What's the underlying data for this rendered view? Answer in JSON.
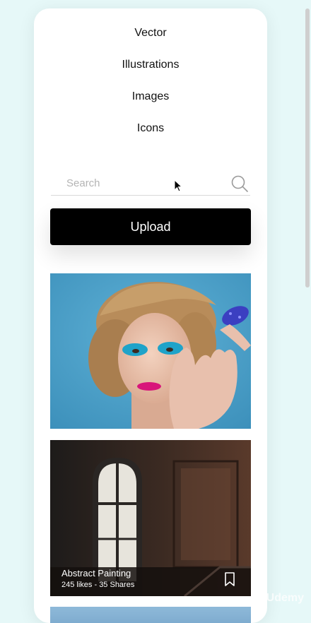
{
  "menu": {
    "items": [
      "Vector",
      "Illustrations",
      "Images",
      "Icons"
    ]
  },
  "search": {
    "placeholder": "Search",
    "value": "",
    "icon": "search-icon"
  },
  "upload": {
    "label": "Upload"
  },
  "cards": [
    {
      "image": "portrait-blue-eyeshadow",
      "title": "",
      "stats": ""
    },
    {
      "image": "abandoned-room-window",
      "title": "Abstract Painting",
      "stats": "245 likes - 35 Shares",
      "icon": "bookmark-icon"
    }
  ],
  "watermark": "Udemy",
  "colors": {
    "background": "#e6f8f8",
    "card": "#ffffff",
    "button": "#000000"
  }
}
